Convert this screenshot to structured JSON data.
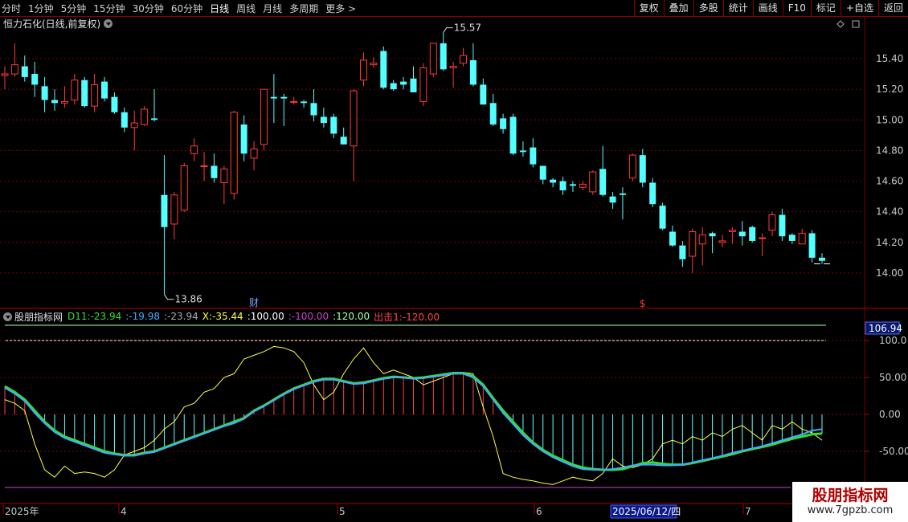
{
  "toolbar": {
    "periods": [
      {
        "label": "分时"
      },
      {
        "label": "1分钟"
      },
      {
        "label": "5分钟"
      },
      {
        "label": "15分钟"
      },
      {
        "label": "30分钟"
      },
      {
        "label": "60分钟"
      },
      {
        "label": "日线"
      },
      {
        "label": "周线"
      },
      {
        "label": "月线"
      },
      {
        "label": "多周期"
      },
      {
        "label": "更多 >"
      }
    ],
    "active_period": "日线",
    "actions": [
      {
        "label": "复权"
      },
      {
        "label": "叠加"
      },
      {
        "label": "多股"
      },
      {
        "label": "统计"
      },
      {
        "label": "画线"
      },
      {
        "label": "F10"
      },
      {
        "label": "标记"
      },
      {
        "label": "+自选"
      },
      {
        "label": "返回"
      }
    ]
  },
  "stock": {
    "title": "恒力石化(日线,前复权)"
  },
  "price_axis": {
    "labels": [
      "15.40",
      "15.20",
      "15.00",
      "14.80",
      "14.60",
      "14.40",
      "14.20",
      "14.00"
    ]
  },
  "annotations": {
    "high": "15.57",
    "low": "13.86",
    "cai": "财",
    "dollar": "$"
  },
  "indicator": {
    "name": "股朋指标网",
    "items": [
      {
        "text": "D11:-23.94",
        "color": "#33dd33"
      },
      {
        "text": ":-19.98",
        "color": "#44aaff"
      },
      {
        "text": ":-23.94",
        "color": "#aaaaaa"
      },
      {
        "text": "X:-35.44",
        "color": "#ffff44"
      },
      {
        "text": ":100.00",
        "color": "#ffffff"
      },
      {
        "text": ":-100.00",
        "color": "#cc44cc"
      },
      {
        "text": ":120.00",
        "color": "#aaffaa"
      },
      {
        "text": "出击1:-120.00",
        "color": "#ff4444"
      }
    ],
    "axis_labels": [
      "100.0",
      "50.00",
      "0.00",
      "-50.00"
    ],
    "current_value": "106.94"
  },
  "date_axis": {
    "labels": [
      "2025年",
      "4",
      "5",
      "6",
      "7"
    ],
    "selected": "2025/06/12/四"
  },
  "watermark": {
    "line1": "股朋指标网",
    "line2": "www.7gpzb.com"
  },
  "colors": {
    "up": "#ff3a3a",
    "down": "#54ffff",
    "grid": "#7a0000",
    "background": "#000000"
  },
  "chart_data": {
    "type": "candlestick",
    "price_ylim": [
      13.8,
      15.6
    ],
    "indicator_ylim": [
      -100,
      120
    ],
    "candles": [
      {
        "o": 15.29,
        "h": 15.35,
        "l": 15.2,
        "c": 15.3
      },
      {
        "o": 15.3,
        "h": 15.5,
        "l": 15.28,
        "c": 15.36
      },
      {
        "o": 15.35,
        "h": 15.42,
        "l": 15.25,
        "c": 15.28
      },
      {
        "o": 15.3,
        "h": 15.38,
        "l": 15.15,
        "c": 15.23
      },
      {
        "o": 15.22,
        "h": 15.28,
        "l": 15.05,
        "c": 15.13
      },
      {
        "o": 15.13,
        "h": 15.2,
        "l": 15.06,
        "c": 15.11
      },
      {
        "o": 15.11,
        "h": 15.22,
        "l": 15.08,
        "c": 15.12
      },
      {
        "o": 15.13,
        "h": 15.3,
        "l": 15.1,
        "c": 15.26
      },
      {
        "o": 15.26,
        "h": 15.28,
        "l": 15.08,
        "c": 15.09
      },
      {
        "o": 15.09,
        "h": 15.3,
        "l": 15.05,
        "c": 15.23
      },
      {
        "o": 15.25,
        "h": 15.28,
        "l": 15.12,
        "c": 15.14
      },
      {
        "o": 15.15,
        "h": 15.18,
        "l": 15.04,
        "c": 15.05
      },
      {
        "o": 15.05,
        "h": 15.08,
        "l": 14.92,
        "c": 14.95
      },
      {
        "o": 14.95,
        "h": 15.06,
        "l": 14.8,
        "c": 14.98
      },
      {
        "o": 14.97,
        "h": 15.09,
        "l": 14.96,
        "c": 15.07
      },
      {
        "o": 15.01,
        "h": 15.2,
        "l": 14.99,
        "c": 15.0
      },
      {
        "o": 14.51,
        "h": 14.77,
        "l": 13.86,
        "c": 14.3
      },
      {
        "o": 14.32,
        "h": 14.53,
        "l": 14.22,
        "c": 14.51
      },
      {
        "o": 14.41,
        "h": 14.72,
        "l": 14.4,
        "c": 14.7
      },
      {
        "o": 14.78,
        "h": 14.88,
        "l": 14.73,
        "c": 14.83
      },
      {
        "o": 14.7,
        "h": 14.79,
        "l": 14.6,
        "c": 14.7
      },
      {
        "o": 14.7,
        "h": 14.78,
        "l": 14.59,
        "c": 14.62
      },
      {
        "o": 14.59,
        "h": 14.7,
        "l": 14.45,
        "c": 14.68
      },
      {
        "o": 14.52,
        "h": 15.06,
        "l": 14.48,
        "c": 15.05
      },
      {
        "o": 14.97,
        "h": 15.03,
        "l": 14.73,
        "c": 14.78
      },
      {
        "o": 14.75,
        "h": 14.86,
        "l": 14.67,
        "c": 14.81
      },
      {
        "o": 14.84,
        "h": 15.2,
        "l": 14.8,
        "c": 15.2
      },
      {
        "o": 15.15,
        "h": 15.3,
        "l": 14.98,
        "c": 15.14
      },
      {
        "o": 15.15,
        "h": 15.17,
        "l": 14.96,
        "c": 15.14
      },
      {
        "o": 15.12,
        "h": 15.15,
        "l": 15.1,
        "c": 15.12
      },
      {
        "o": 15.12,
        "h": 15.13,
        "l": 15.08,
        "c": 15.11
      },
      {
        "o": 15.11,
        "h": 15.2,
        "l": 14.99,
        "c": 15.03
      },
      {
        "o": 15.02,
        "h": 15.08,
        "l": 14.95,
        "c": 14.98
      },
      {
        "o": 15.02,
        "h": 15.04,
        "l": 14.88,
        "c": 14.91
      },
      {
        "o": 14.89,
        "h": 14.95,
        "l": 14.84,
        "c": 14.84
      },
      {
        "o": 14.83,
        "h": 15.2,
        "l": 14.6,
        "c": 15.19
      },
      {
        "o": 15.26,
        "h": 15.44,
        "l": 15.22,
        "c": 15.39
      },
      {
        "o": 15.36,
        "h": 15.41,
        "l": 15.34,
        "c": 15.37
      },
      {
        "o": 15.45,
        "h": 15.48,
        "l": 15.2,
        "c": 15.21
      },
      {
        "o": 15.24,
        "h": 15.26,
        "l": 15.19,
        "c": 15.2
      },
      {
        "o": 15.25,
        "h": 15.28,
        "l": 15.2,
        "c": 15.23
      },
      {
        "o": 15.27,
        "h": 15.35,
        "l": 15.2,
        "c": 15.18
      },
      {
        "o": 15.12,
        "h": 15.37,
        "l": 15.09,
        "c": 15.34
      },
      {
        "o": 15.3,
        "h": 15.5,
        "l": 15.28,
        "c": 15.5
      },
      {
        "o": 15.5,
        "h": 15.57,
        "l": 15.32,
        "c": 15.33
      },
      {
        "o": 15.34,
        "h": 15.38,
        "l": 15.21,
        "c": 15.35
      },
      {
        "o": 15.37,
        "h": 15.47,
        "l": 15.35,
        "c": 15.42
      },
      {
        "o": 15.39,
        "h": 15.5,
        "l": 15.22,
        "c": 15.23
      },
      {
        "o": 15.23,
        "h": 15.27,
        "l": 15.11,
        "c": 15.1
      },
      {
        "o": 15.11,
        "h": 15.17,
        "l": 14.96,
        "c": 14.97
      },
      {
        "o": 15.01,
        "h": 15.04,
        "l": 14.91,
        "c": 14.94
      },
      {
        "o": 15.02,
        "h": 15.04,
        "l": 14.77,
        "c": 14.78
      },
      {
        "o": 14.8,
        "h": 14.86,
        "l": 14.76,
        "c": 14.79
      },
      {
        "o": 14.82,
        "h": 14.88,
        "l": 14.69,
        "c": 14.71
      },
      {
        "o": 14.7,
        "h": 14.7,
        "l": 14.58,
        "c": 14.61
      },
      {
        "o": 14.61,
        "h": 14.62,
        "l": 14.56,
        "c": 14.59
      },
      {
        "o": 14.6,
        "h": 14.63,
        "l": 14.51,
        "c": 14.54
      },
      {
        "o": 14.58,
        "h": 14.6,
        "l": 14.53,
        "c": 14.57
      },
      {
        "o": 14.56,
        "h": 14.6,
        "l": 14.54,
        "c": 14.58
      },
      {
        "o": 14.53,
        "h": 14.67,
        "l": 14.51,
        "c": 14.66
      },
      {
        "o": 14.68,
        "h": 14.83,
        "l": 14.5,
        "c": 14.51
      },
      {
        "o": 14.5,
        "h": 14.53,
        "l": 14.42,
        "c": 14.46
      },
      {
        "o": 14.52,
        "h": 14.56,
        "l": 14.35,
        "c": 14.51
      },
      {
        "o": 14.62,
        "h": 14.78,
        "l": 14.6,
        "c": 14.77
      },
      {
        "o": 14.77,
        "h": 14.81,
        "l": 14.56,
        "c": 14.59
      },
      {
        "o": 14.59,
        "h": 14.62,
        "l": 14.43,
        "c": 14.45
      },
      {
        "o": 14.44,
        "h": 14.46,
        "l": 14.28,
        "c": 14.29
      },
      {
        "o": 14.27,
        "h": 14.31,
        "l": 14.17,
        "c": 14.18
      },
      {
        "o": 14.18,
        "h": 14.21,
        "l": 14.04,
        "c": 14.09
      },
      {
        "o": 14.11,
        "h": 14.29,
        "l": 14.0,
        "c": 14.27
      },
      {
        "o": 14.19,
        "h": 14.3,
        "l": 14.05,
        "c": 14.25
      },
      {
        "o": 14.26,
        "h": 14.27,
        "l": 14.13,
        "c": 14.24
      },
      {
        "o": 14.2,
        "h": 14.25,
        "l": 14.17,
        "c": 14.21
      },
      {
        "o": 14.27,
        "h": 14.3,
        "l": 14.19,
        "c": 14.28
      },
      {
        "o": 14.27,
        "h": 14.34,
        "l": 14.18,
        "c": 14.24
      },
      {
        "o": 14.3,
        "h": 14.31,
        "l": 14.2,
        "c": 14.21
      },
      {
        "o": 14.23,
        "h": 14.26,
        "l": 14.11,
        "c": 14.23
      },
      {
        "o": 14.28,
        "h": 14.4,
        "l": 14.24,
        "c": 14.38
      },
      {
        "o": 14.38,
        "h": 14.42,
        "l": 14.21,
        "c": 14.24
      },
      {
        "o": 14.25,
        "h": 14.26,
        "l": 14.19,
        "c": 14.21
      },
      {
        "o": 14.19,
        "h": 14.29,
        "l": 14.19,
        "c": 14.26
      },
      {
        "o": 14.26,
        "h": 14.28,
        "l": 14.07,
        "c": 14.1
      },
      {
        "o": 14.1,
        "h": 14.13,
        "l": 14.06,
        "c": 14.08
      }
    ],
    "indicator": {
      "d11": [
        38,
        30,
        20,
        5,
        -10,
        -22,
        -30,
        -35,
        -40,
        -45,
        -50,
        -53,
        -55,
        -55,
        -52,
        -50,
        -45,
        -40,
        -35,
        -30,
        -25,
        -20,
        -15,
        -10,
        -5,
        5,
        12,
        20,
        28,
        35,
        40,
        45,
        48,
        48,
        45,
        42,
        43,
        46,
        49,
        51,
        50,
        49,
        50,
        52,
        54,
        56,
        56,
        52,
        40,
        22,
        5,
        -10,
        -25,
        -38,
        -48,
        -56,
        -62,
        -68,
        -72,
        -74,
        -75,
        -75,
        -74,
        -70,
        -66,
        -65,
        -67,
        -68,
        -68,
        -66,
        -63,
        -60,
        -57,
        -54,
        -50,
        -47,
        -44,
        -41,
        -37,
        -33,
        -30,
        -27,
        -26
      ],
      "k": [
        36,
        28,
        18,
        2,
        -12,
        -24,
        -32,
        -37,
        -42,
        -47,
        -52,
        -54,
        -56,
        -56,
        -53,
        -51,
        -46,
        -41,
        -36,
        -31,
        -26,
        -21,
        -16,
        -12,
        -6,
        4,
        11,
        19,
        27,
        34,
        39,
        44,
        47,
        47,
        44,
        41,
        42,
        45,
        48,
        50,
        50,
        48,
        49,
        51,
        53,
        55,
        55,
        50,
        38,
        20,
        2,
        -13,
        -28,
        -40,
        -50,
        -58,
        -64,
        -70,
        -74,
        -75,
        -75,
        -74,
        -72,
        -69,
        -68,
        -68,
        -69,
        -69,
        -68,
        -65,
        -62,
        -59,
        -56,
        -52,
        -49,
        -46,
        -43,
        -39,
        -35,
        -31,
        -27,
        -22,
        -20
      ],
      "x": [
        20,
        15,
        5,
        -40,
        -75,
        -85,
        -70,
        -80,
        -78,
        -80,
        -85,
        -75,
        -55,
        -50,
        -45,
        -35,
        -20,
        -10,
        10,
        15,
        30,
        35,
        50,
        55,
        75,
        80,
        85,
        92,
        90,
        85,
        70,
        40,
        20,
        30,
        55,
        75,
        90,
        70,
        55,
        60,
        55,
        50,
        40,
        45,
        50,
        55,
        57,
        55,
        10,
        -30,
        -80,
        -85,
        -88,
        -90,
        -93,
        -95,
        -90,
        -85,
        -88,
        -90,
        -80,
        -60,
        -70,
        -72,
        -68,
        -60,
        -40,
        -35,
        -40,
        -30,
        -35,
        -25,
        -30,
        -20,
        -15,
        -25,
        -35,
        -15,
        -20,
        -10,
        -20,
        -25,
        -35
      ],
      "ref_lines": [
        120,
        100,
        -100
      ]
    }
  }
}
